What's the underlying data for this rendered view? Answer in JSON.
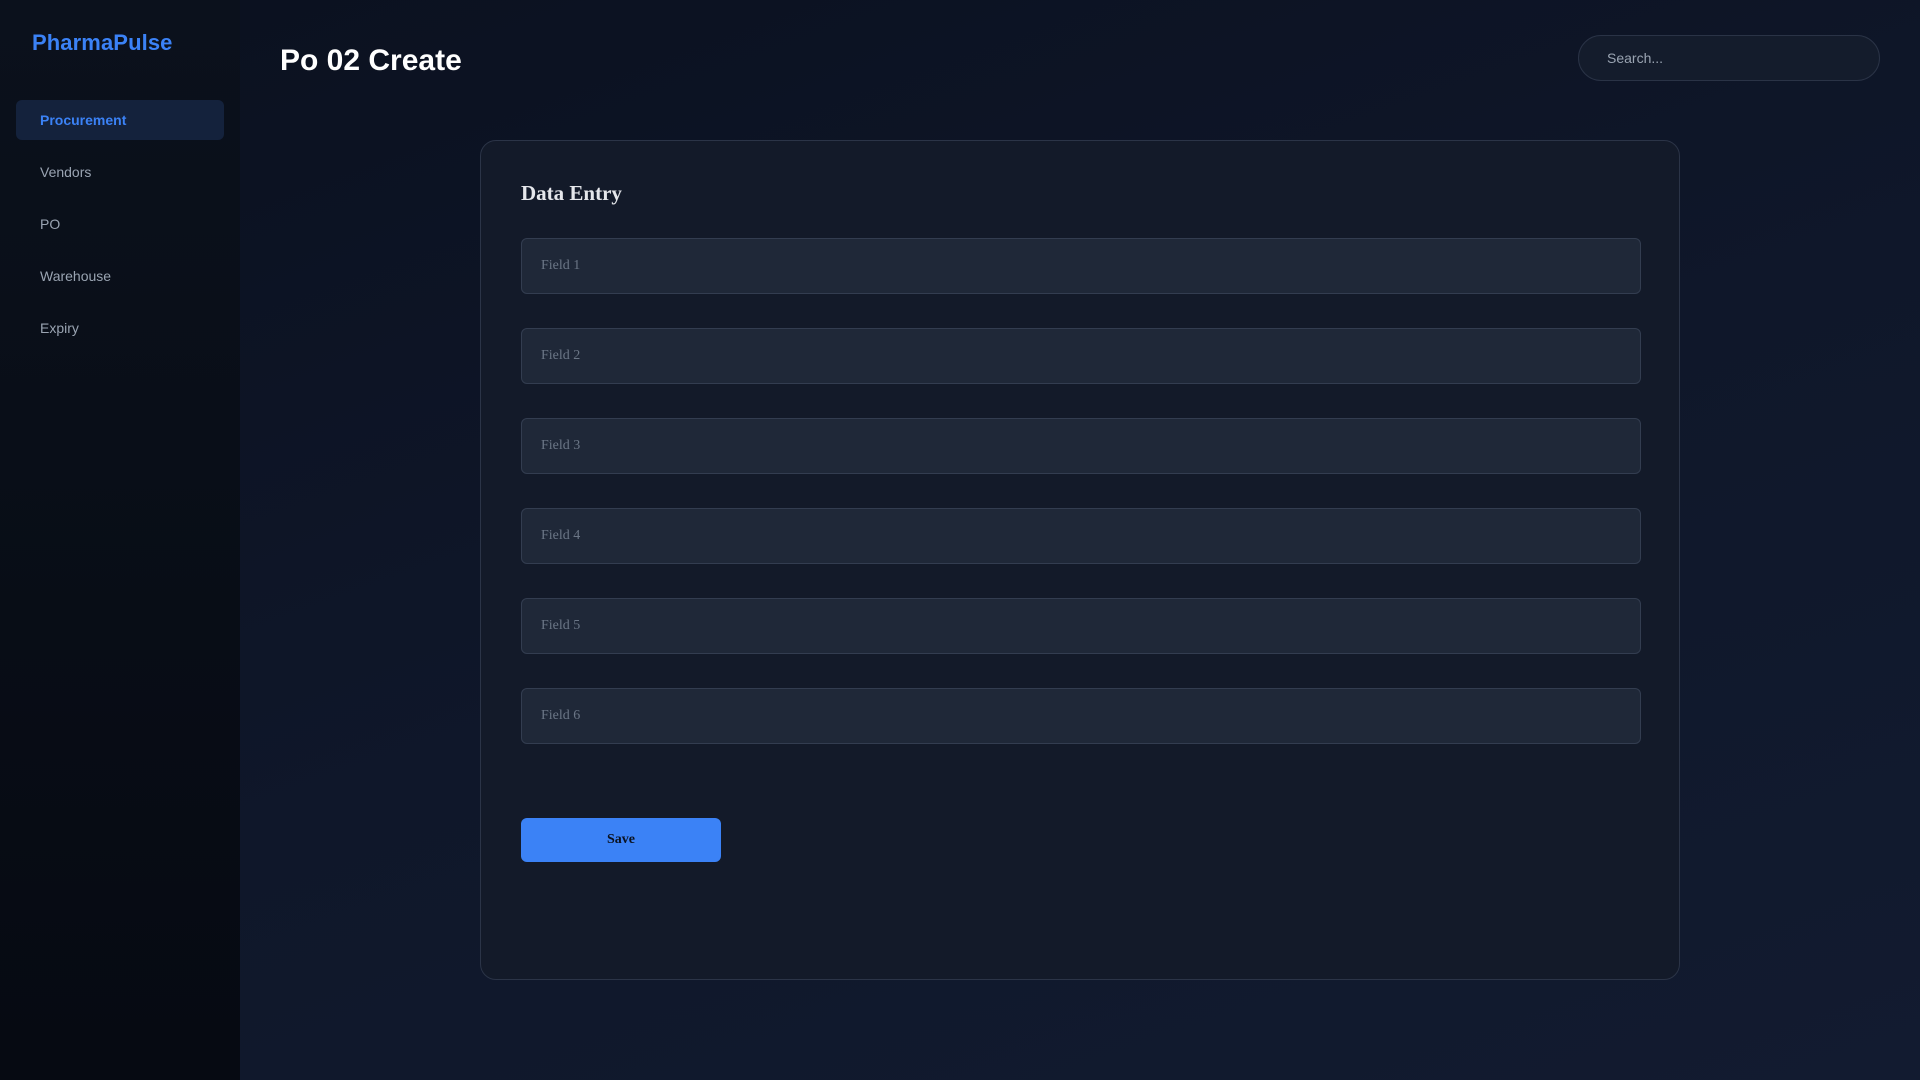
{
  "app": {
    "name": "PharmaPulse"
  },
  "sidebar": {
    "items": [
      {
        "label": "Procurement",
        "active": true
      },
      {
        "label": "Vendors",
        "active": false
      },
      {
        "label": "PO",
        "active": false
      },
      {
        "label": "Warehouse",
        "active": false
      },
      {
        "label": "Expiry",
        "active": false
      }
    ]
  },
  "header": {
    "title": "Po 02 Create",
    "search_placeholder": "Search..."
  },
  "form": {
    "title": "Data Entry",
    "fields": [
      {
        "placeholder": "Field 1",
        "value": ""
      },
      {
        "placeholder": "Field 2",
        "value": ""
      },
      {
        "placeholder": "Field 3",
        "value": ""
      },
      {
        "placeholder": "Field 4",
        "value": ""
      },
      {
        "placeholder": "Field 5",
        "value": ""
      },
      {
        "placeholder": "Field 6",
        "value": ""
      }
    ],
    "save_label": "Save"
  },
  "colors": {
    "accent": "#3b82f6",
    "background": "#0f172a",
    "card": "#131a29",
    "sidebar": "#080d16"
  }
}
